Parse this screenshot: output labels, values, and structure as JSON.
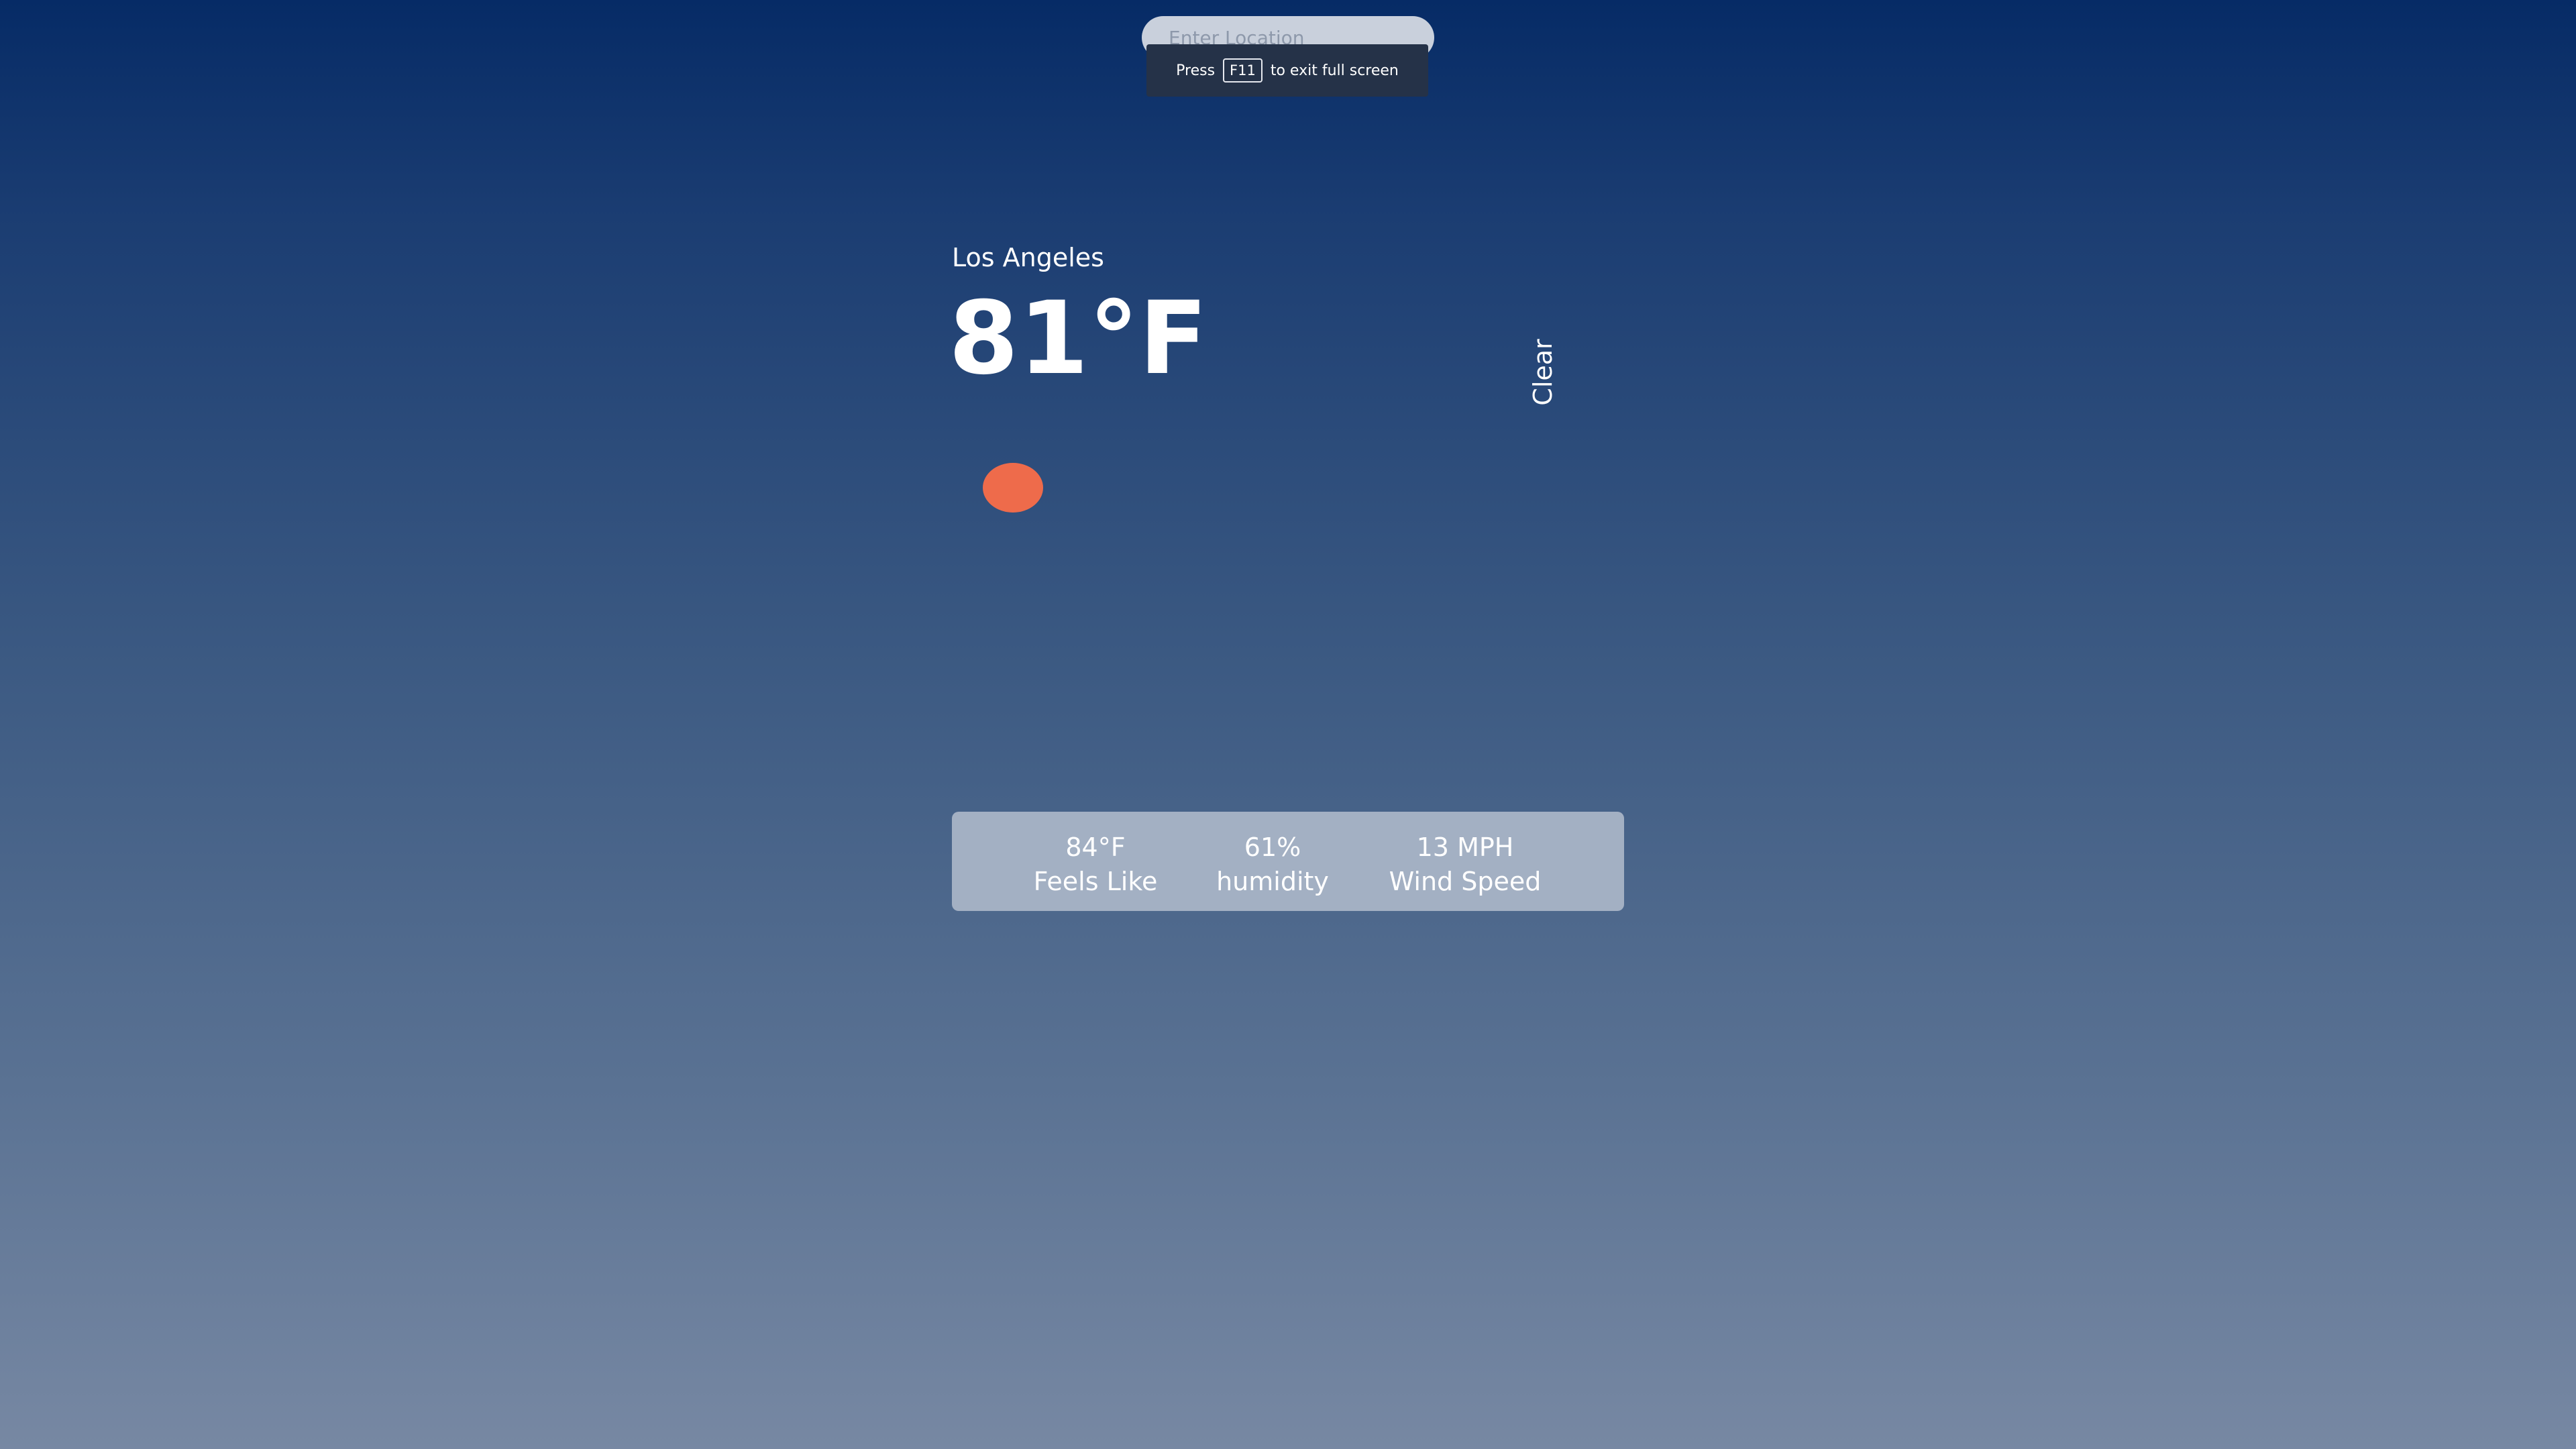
{
  "search": {
    "placeholder": "Enter Location",
    "value": ""
  },
  "fullscreen_notice": {
    "prefix": "Press",
    "key": "F11",
    "suffix": "to exit full screen"
  },
  "weather": {
    "city": "Los Angeles",
    "temperature": "81°F",
    "condition": "Clear",
    "icon": "sun-icon"
  },
  "stats": {
    "feels_like": {
      "value": "84°F",
      "label": "Feels Like"
    },
    "humidity": {
      "value": "61%",
      "label": "humidity"
    },
    "wind_speed": {
      "value": "13 MPH",
      "label": "Wind Speed"
    }
  },
  "colors": {
    "background_top": "#062b66",
    "background_bottom": "#7788a3",
    "sun": "#ee6b4b",
    "stats_panel": "#a3b0c3"
  }
}
